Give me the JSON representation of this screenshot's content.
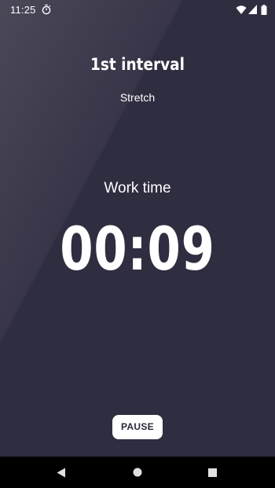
{
  "status_bar": {
    "time": "11:25",
    "icons": {
      "left": "stopwatch-icon",
      "right": [
        "wifi-icon",
        "signal-icon",
        "battery-icon"
      ]
    }
  },
  "interval": {
    "title": "1st interval",
    "exercise": "Stretch"
  },
  "timer": {
    "phase": "Work time",
    "remaining": "00:09"
  },
  "controls": {
    "pause_label": "PAUSE"
  },
  "nav_bar": {
    "icons": [
      "back-icon",
      "home-icon",
      "recents-icon"
    ]
  },
  "colors": {
    "background": "#2f2d40",
    "text": "#ffffff",
    "button_bg": "#ffffff",
    "button_text": "#2b2a39",
    "nav_bg": "#000000"
  }
}
